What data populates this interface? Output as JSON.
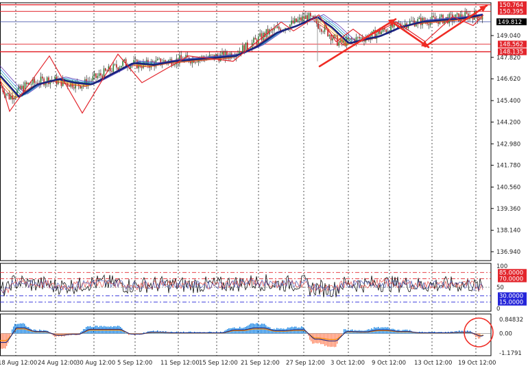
{
  "chart_data": {
    "type": "candlestick",
    "price_axis": {
      "ticks": [
        "149.040",
        "147.820",
        "146.620",
        "145.400",
        "144.200",
        "142.980",
        "141.780",
        "140.560",
        "139.360",
        "138.140",
        "136.940"
      ],
      "range": [
        136.3,
        151.2
      ]
    },
    "time_axis": {
      "labels": [
        "18 Aug 12:00",
        "24 Aug 12:00",
        "30 Aug 12:00",
        "5 Sep 12:00",
        "11 Sep 12:00",
        "15 Sep 12:00",
        "21 Sep 12:00",
        "27 Sep 12:00",
        "3 Oct 12:00",
        "9 Oct 12:00",
        "13 Oct 12:00",
        "19 Oct 12:00"
      ]
    },
    "price_lines": [
      {
        "label": "150.764",
        "value": 150.764,
        "color": "#e3262d",
        "style": "solid"
      },
      {
        "label": "150.395",
        "value": 150.395,
        "color": "#e3262d",
        "style": "solid"
      },
      {
        "label": "148.562",
        "value": 148.562,
        "color": "#e3262d",
        "style": "solid"
      },
      {
        "label": "148.135",
        "value": 148.135,
        "color": "#e3262d",
        "style": "solid"
      }
    ],
    "current_price": {
      "label": "149.812",
      "value": 149.812
    },
    "price_series": [
      [
        0,
        146.2
      ],
      [
        14,
        145.6
      ],
      [
        40,
        146.3
      ],
      [
        72,
        146.6
      ],
      [
        95,
        146.4
      ],
      [
        120,
        146.3
      ],
      [
        150,
        146.9
      ],
      [
        180,
        147.5
      ],
      [
        210,
        147.4
      ],
      [
        240,
        147.6
      ],
      [
        270,
        147.7
      ],
      [
        300,
        147.8
      ],
      [
        330,
        147.9
      ],
      [
        360,
        148.4
      ],
      [
        390,
        149.2
      ],
      [
        420,
        149.6
      ],
      [
        448,
        150.1
      ],
      [
        470,
        149.5
      ],
      [
        495,
        148.6
      ],
      [
        515,
        148.8
      ],
      [
        540,
        149.0
      ],
      [
        570,
        149.5
      ],
      [
        600,
        149.8
      ],
      [
        630,
        149.9
      ],
      [
        660,
        150.0
      ],
      [
        690,
        150.2
      ],
      [
        705,
        150.0
      ]
    ],
    "zigzag": [
      [
        0,
        146.6
      ],
      [
        14,
        144.8
      ],
      [
        72,
        147.9
      ],
      [
        120,
        144.7
      ],
      [
        172,
        148.0
      ],
      [
        207,
        146.4
      ],
      [
        275,
        147.9
      ],
      [
        340,
        147.6
      ],
      [
        410,
        149.8
      ],
      [
        428,
        149.3
      ],
      [
        465,
        150.2
      ],
      [
        490,
        148.7
      ],
      [
        515,
        149.4
      ],
      [
        532,
        148.9
      ],
      [
        578,
        149.8
      ],
      [
        620,
        148.7
      ],
      [
        660,
        150.1
      ],
      [
        690,
        149.6
      ],
      [
        705,
        150.2
      ]
    ],
    "arrows": [
      [
        [
          466,
          97
        ],
        [
          577,
          28
        ]
      ],
      [
        [
          570,
          31
        ],
        [
          625,
          69
        ]
      ],
      [
        [
          620,
          68
        ],
        [
          710,
          8
        ]
      ]
    ],
    "rsi_panel": {
      "range": [
        0,
        100
      ],
      "ticks": [
        "100",
        "50",
        "0"
      ],
      "levels": [
        {
          "label": "85.0000",
          "value": 85,
          "color": "#e3262d"
        },
        {
          "label": "70.0000",
          "value": 70,
          "color": "#e3262d"
        },
        {
          "label": "30.0000",
          "value": 30,
          "color": "#2525d9"
        },
        {
          "label": "15.0000",
          "value": 15,
          "color": "#2525d9"
        }
      ]
    },
    "macd_panel": {
      "ticks": [
        "0.84832",
        "0.00",
        "-1.1791"
      ],
      "range": [
        -1.1791,
        0.84832
      ]
    }
  }
}
